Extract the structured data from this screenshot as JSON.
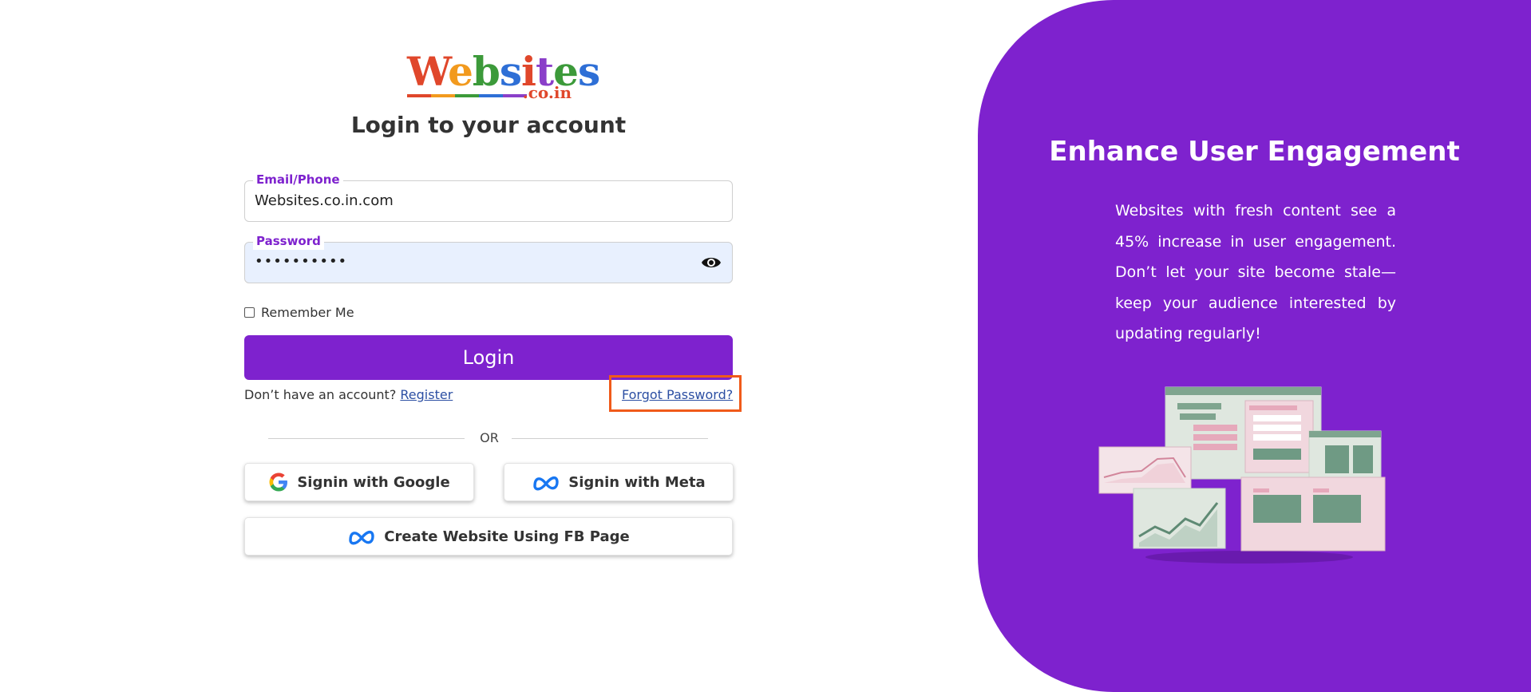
{
  "logo": {
    "letters": [
      "W",
      "e",
      "b",
      "s",
      "i",
      "t",
      "e",
      "s"
    ],
    "sub": ".co.in"
  },
  "form": {
    "title": "Login to your account",
    "email_label": "Email/Phone",
    "email_value": "Websites.co.in.com",
    "password_label": "Password",
    "password_value": "••••••••••",
    "remember_label": "Remember Me",
    "login_label": "Login",
    "no_account_text": "Don’t have an account?",
    "register_label": "Register",
    "forgot_label": "Forgot Password?",
    "or_text": "OR",
    "google_label": "Signin with Google",
    "meta_label": "Signin with Meta",
    "fb_label": "Create Website Using FB Page"
  },
  "panel": {
    "title": "Enhance User Engagement",
    "text": "Websites with fresh content see a 45% increase in user engagement. Don’t let your site become stale—keep your audience interested by updating regularly!",
    "bg_color": "#7e22ce"
  },
  "colors": {
    "accent": "#7e22ce",
    "highlight": "#f05a1a",
    "link": "#2c4fa3"
  },
  "icons": [
    "eye-icon",
    "google-icon",
    "meta-icon",
    "meta-icon"
  ]
}
